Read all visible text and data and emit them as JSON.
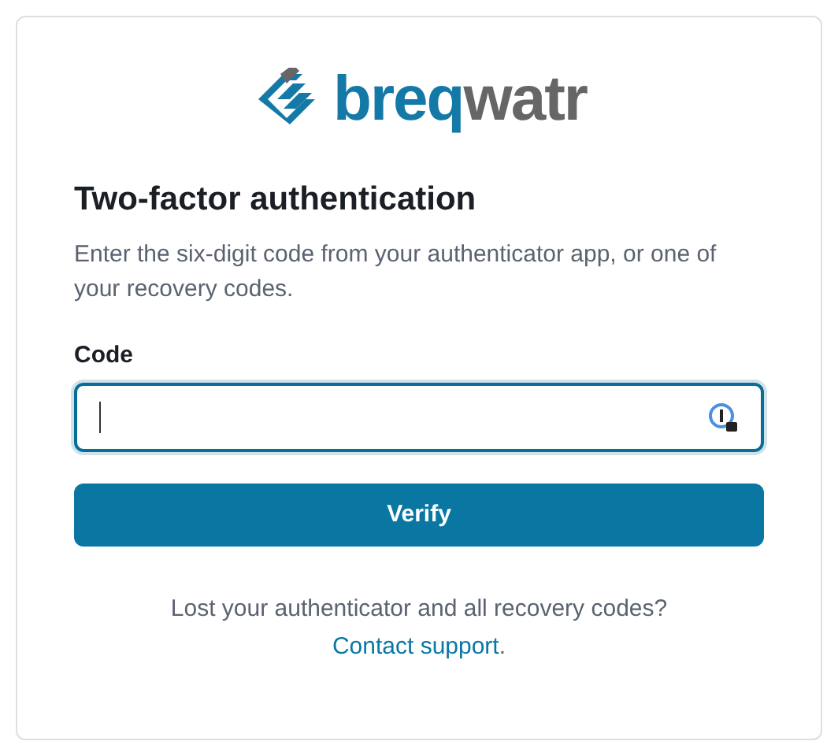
{
  "logo": {
    "part_1": "breq",
    "part_2": "watr"
  },
  "heading": "Two-factor authentication",
  "description": "Enter the six-digit code from your authenticator app, or one of your recovery codes.",
  "code_field": {
    "label": "Code",
    "focused": true
  },
  "verify_button": "Verify",
  "footer": {
    "text": "Lost your authenticator and all recovery codes?",
    "link": "Contact support",
    "end": "."
  }
}
